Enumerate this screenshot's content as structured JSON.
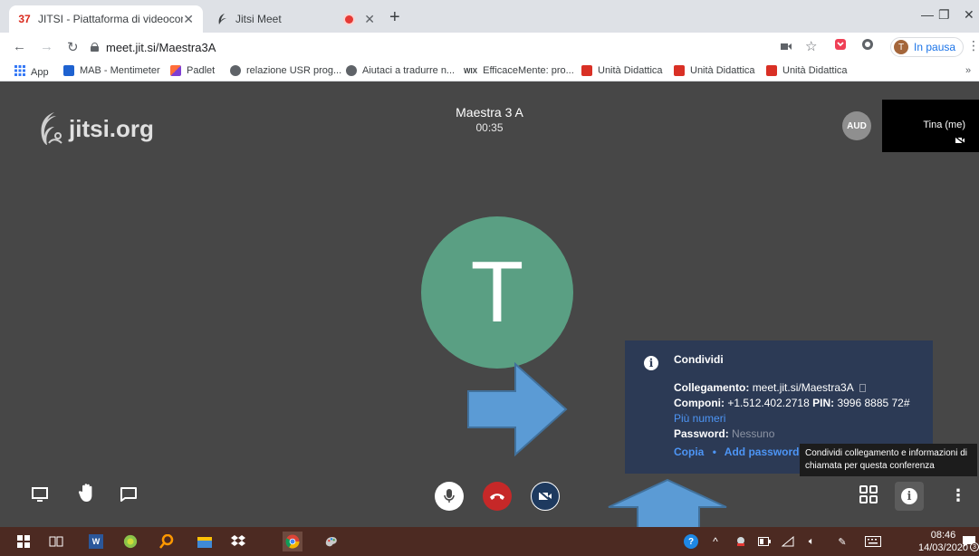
{
  "browser": {
    "tabs": [
      {
        "title": "JITSI - Piattaforma di videoconfer",
        "favicon_text": "37",
        "favicon_color": "#d9291c"
      },
      {
        "title": "Jitsi Meet"
      }
    ],
    "url": "meet.jit.si/Maestra3A",
    "profile_initial": "T",
    "profile_label": "In pausa"
  },
  "bookmarks": [
    {
      "label": "App",
      "color": "#3478f6"
    },
    {
      "label": "MAB - Mentimeter",
      "color": "#1e62d0"
    },
    {
      "label": "Padlet",
      "color": "#ff6e3a"
    },
    {
      "label": "relazione USR prog...",
      "color": "#5f6368"
    },
    {
      "label": "Aiutaci a tradurre n...",
      "color": "#5f6368"
    },
    {
      "label": "EfficaceMente: pro...",
      "color": "#000000"
    },
    {
      "label": "Unità Didattica",
      "color": "#d93025"
    },
    {
      "label": "Unità Didattica",
      "color": "#d93025"
    },
    {
      "label": "Unità Didattica",
      "color": "#d93025"
    }
  ],
  "meeting": {
    "logo_text": "jitsi.org",
    "title": "Maestra 3 A",
    "timer": "00:35",
    "aud_badge": "AUD",
    "self_name": "Tina (me)",
    "avatar_initial": "T",
    "avatar_color": "#5a9f83"
  },
  "info_panel": {
    "title": "Condividi",
    "link_label": "Collegamento:",
    "link_value": "meet.jit.si/Maestra3A",
    "dial_label": "Componi:",
    "dial_value": "+1.512.402.2718",
    "pin_label": "PIN:",
    "pin_value": "3996 8885 72#",
    "more_numbers": "Più numeri",
    "password_label": "Password:",
    "password_value": "Nessuno",
    "copy_action": "Copia",
    "separator": "•",
    "add_password_action": "Add password"
  },
  "tooltip": "Condividi collegamento e informazioni di chiamata per questa conferenza",
  "taskbar": {
    "time": "08:46",
    "date": "14/03/2020",
    "notification_count": "3"
  }
}
